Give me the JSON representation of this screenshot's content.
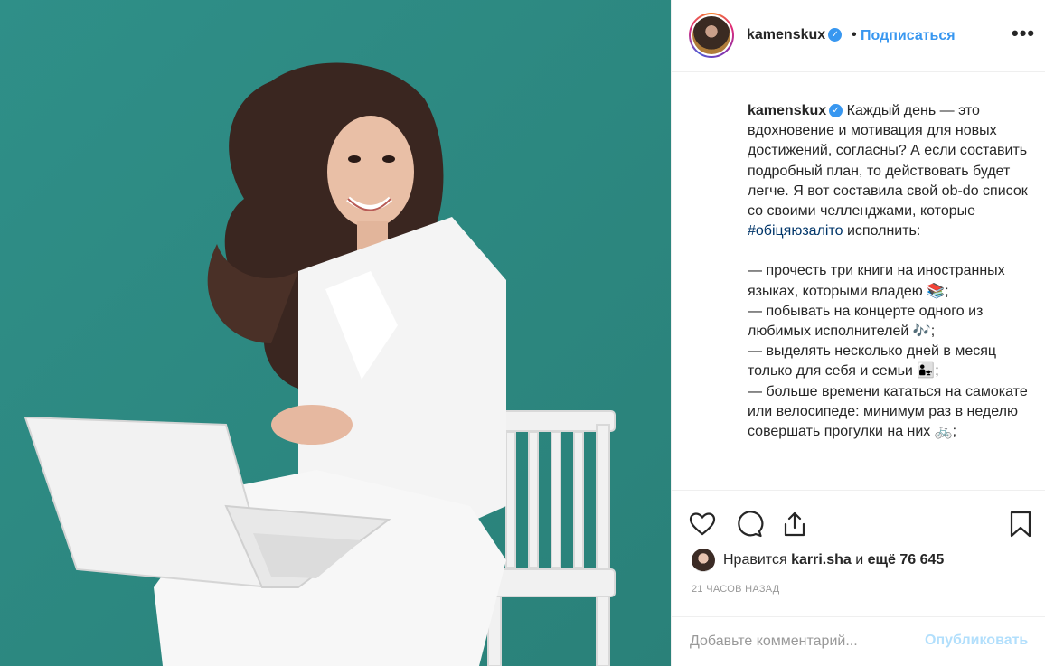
{
  "post": {
    "username": "kamenskux",
    "verified_glyph": "✓",
    "separator": "•",
    "follow_label": "Подписаться",
    "more_label": "•••"
  },
  "caption": {
    "username": "kamenskux",
    "text_before_tag": "Каждый день — это вдохновение и мотивация для новых достижений, согласны? А если составить подробный план, то действовать будет легче. Я вот составила свой ob-do список со своими челленджами, которые ",
    "hashtag": "#обіцяюзаліто",
    "text_after_tag": " исполнить:",
    "list": "— прочесть три книги на иностранных языках, которыми владею 📚;\n— побывать на концерте одного из любимых исполнителей 🎶;\n— выделять несколько дней в месяц только для себя и семьи 👨‍👧;\n— больше времени кататься на самокате или велосипеде: минимум раз в неделю совершать прогулки на них 🚲;"
  },
  "actions": {
    "like_icon": "heart-icon",
    "comment_icon": "comment-icon",
    "share_icon": "share-icon",
    "save_icon": "bookmark-icon"
  },
  "likes": {
    "prefix": "Нравится",
    "user": "karri.sha",
    "middle": "и",
    "count": "ещё 76 645"
  },
  "timestamp": "21 ЧАСОВ НАЗАД",
  "comment": {
    "placeholder": "Добавьте комментарий...",
    "post_label": "Опубликовать"
  },
  "colors": {
    "photo_background": "#2f8e86",
    "link_blue": "#3897f0",
    "hashtag": "#003569",
    "post_disabled": "#b2dffc"
  }
}
